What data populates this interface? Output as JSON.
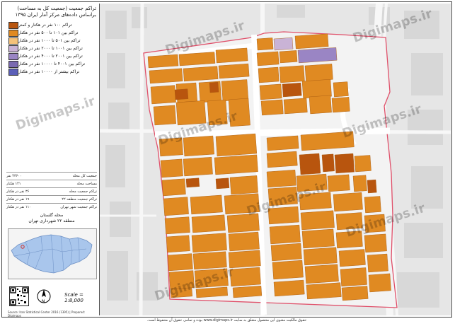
{
  "legend": {
    "title": "تراکم جمعیت (جمعیت کل به مساحت) براساس داده‌های مرکز آمار ایران ۱۳۹۵",
    "classes": [
      {
        "label": "تراکم ۱۰۰ نفر در هکتار و کمتر",
        "color": "#b8550e"
      },
      {
        "label": "تراکم بین ۱۰۱ تا ۵۰۰ نفر در هکتار",
        "color": "#e08a22"
      },
      {
        "label": "تراکم بین ۵۰۱ تا ۱۰۰۰ نفر در هکتار",
        "color": "#f5c27a"
      },
      {
        "label": "تراکم بین ۱۰۰۱ تا ۲۰۰۰ نفر در هکتار",
        "color": "#c9b3d6"
      },
      {
        "label": "تراکم بین ۲۰۰۱ تا ۴۰۰۰ نفر در هکتار",
        "color": "#9a85c4"
      },
      {
        "label": "تراکم بین ۴۰۰۱ تا ۱۰۰۰۰ نفر در هکتار",
        "color": "#7a6ab0"
      },
      {
        "label": "تراکم بیشتر از ۱۰۰۰۰ نفر در هکتار",
        "color": "#5b5fb8"
      }
    ]
  },
  "stats": [
    {
      "label": "جمعیت کل محله",
      "value": "۴۳۶۰۰ نفر"
    },
    {
      "label": "مساحت محله",
      "value": "۱۲۱ هکتار"
    },
    {
      "label": "تراکم جمعیت محله",
      "value": "۳۶ نفر در هکتار"
    },
    {
      "label": "تراکم جمعیت منطقه ۲۲",
      "value": "۱۹ نفر در هکتار"
    },
    {
      "label": "تراکم جمعیت شهر تهران",
      "value": "۱۱۰ نفر در هکتار"
    }
  ],
  "inset": {
    "title": "محله گلستان\nمنطقه ۲۲ شهرداری تهران"
  },
  "scale": "Scale = 1:8,000",
  "credit_small": "Source: Iran Statistical Center 2016 (1395) | Prepared: Digimaps",
  "footer": "حقوق مالکیت معنوی این محصول متعلق به سایت www.digimaps.ir بوده و تمامی حقوق آن محفوظ است.",
  "watermark": "Digimaps.ir",
  "colors": {
    "dark": "#b8550e",
    "orange": "#e08a22",
    "light": "#f5c27a",
    "purple": "#9a85c4",
    "lavender": "#c9b3d6",
    "boundary": "#e0506a"
  }
}
